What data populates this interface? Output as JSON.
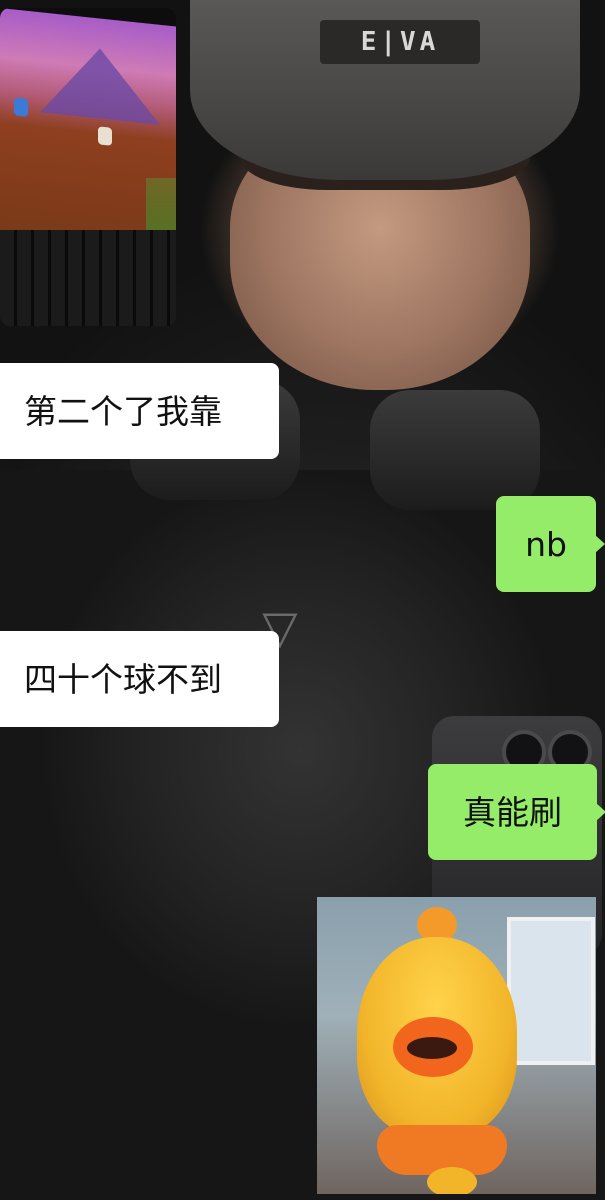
{
  "background": {
    "beanie_logo_text": "E|VA",
    "shirt_logo_glyph": "▽"
  },
  "thumbnail": {
    "icon": "game-screenshot-image"
  },
  "messages": [
    {
      "side": "left",
      "text": "第二个了我靠"
    },
    {
      "side": "right",
      "text": "nb"
    },
    {
      "side": "left",
      "text": "四十个球不到"
    },
    {
      "side": "right",
      "text": "真能刷"
    }
  ],
  "sticker": {
    "icon": "crying-cartoon-sticker"
  },
  "colors": {
    "outgoing_bubble": "#95ec69",
    "incoming_bubble": "#ffffff",
    "text": "#111111"
  }
}
